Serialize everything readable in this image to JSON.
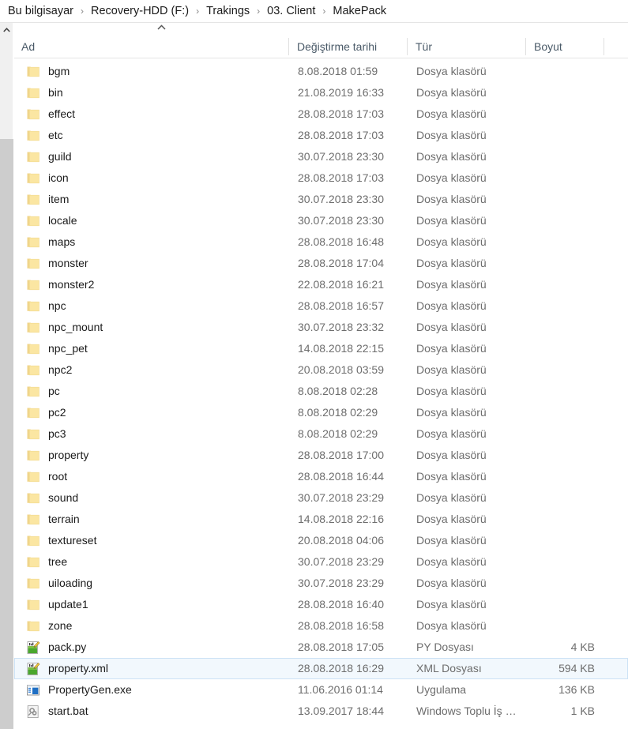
{
  "breadcrumb": {
    "separator": "›",
    "items": [
      {
        "label": "Bu bilgisayar"
      },
      {
        "label": "Recovery-HDD (F:)"
      },
      {
        "label": "Trakings"
      },
      {
        "label": "03. Client"
      },
      {
        "label": "MakePack"
      }
    ]
  },
  "columns": {
    "name": "Ad",
    "date": "Değiştirme tarihi",
    "type": "Tür",
    "size": "Boyut",
    "sort_indicator": "ascending-caret"
  },
  "scrollbar": {
    "up_arrow_icon": "chevron-up-icon"
  },
  "types": {
    "folder": "Dosya klasörü"
  },
  "rows": [
    {
      "name": "bgm",
      "date": "8.08.2018 01:59",
      "type": "Dosya klasörü",
      "size": "",
      "icon": "folder-icon",
      "selected": false
    },
    {
      "name": "bin",
      "date": "21.08.2019 16:33",
      "type": "Dosya klasörü",
      "size": "",
      "icon": "folder-icon",
      "selected": false
    },
    {
      "name": "effect",
      "date": "28.08.2018 17:03",
      "type": "Dosya klasörü",
      "size": "",
      "icon": "folder-icon",
      "selected": false
    },
    {
      "name": "etc",
      "date": "28.08.2018 17:03",
      "type": "Dosya klasörü",
      "size": "",
      "icon": "folder-icon",
      "selected": false
    },
    {
      "name": "guild",
      "date": "30.07.2018 23:30",
      "type": "Dosya klasörü",
      "size": "",
      "icon": "folder-icon",
      "selected": false
    },
    {
      "name": "icon",
      "date": "28.08.2018 17:03",
      "type": "Dosya klasörü",
      "size": "",
      "icon": "folder-icon",
      "selected": false
    },
    {
      "name": "item",
      "date": "30.07.2018 23:30",
      "type": "Dosya klasörü",
      "size": "",
      "icon": "folder-icon",
      "selected": false
    },
    {
      "name": "locale",
      "date": "30.07.2018 23:30",
      "type": "Dosya klasörü",
      "size": "",
      "icon": "folder-icon",
      "selected": false
    },
    {
      "name": "maps",
      "date": "28.08.2018 16:48",
      "type": "Dosya klasörü",
      "size": "",
      "icon": "folder-icon",
      "selected": false
    },
    {
      "name": "monster",
      "date": "28.08.2018 17:04",
      "type": "Dosya klasörü",
      "size": "",
      "icon": "folder-icon",
      "selected": false
    },
    {
      "name": "monster2",
      "date": "22.08.2018 16:21",
      "type": "Dosya klasörü",
      "size": "",
      "icon": "folder-icon",
      "selected": false
    },
    {
      "name": "npc",
      "date": "28.08.2018 16:57",
      "type": "Dosya klasörü",
      "size": "",
      "icon": "folder-icon",
      "selected": false
    },
    {
      "name": "npc_mount",
      "date": "30.07.2018 23:32",
      "type": "Dosya klasörü",
      "size": "",
      "icon": "folder-icon",
      "selected": false
    },
    {
      "name": "npc_pet",
      "date": "14.08.2018 22:15",
      "type": "Dosya klasörü",
      "size": "",
      "icon": "folder-icon",
      "selected": false
    },
    {
      "name": "npc2",
      "date": "20.08.2018 03:59",
      "type": "Dosya klasörü",
      "size": "",
      "icon": "folder-icon",
      "selected": false
    },
    {
      "name": "pc",
      "date": "8.08.2018 02:28",
      "type": "Dosya klasörü",
      "size": "",
      "icon": "folder-icon",
      "selected": false
    },
    {
      "name": "pc2",
      "date": "8.08.2018 02:29",
      "type": "Dosya klasörü",
      "size": "",
      "icon": "folder-icon",
      "selected": false
    },
    {
      "name": "pc3",
      "date": "8.08.2018 02:29",
      "type": "Dosya klasörü",
      "size": "",
      "icon": "folder-icon",
      "selected": false
    },
    {
      "name": "property",
      "date": "28.08.2018 17:00",
      "type": "Dosya klasörü",
      "size": "",
      "icon": "folder-icon",
      "selected": false
    },
    {
      "name": "root",
      "date": "28.08.2018 16:44",
      "type": "Dosya klasörü",
      "size": "",
      "icon": "folder-icon",
      "selected": false
    },
    {
      "name": "sound",
      "date": "30.07.2018 23:29",
      "type": "Dosya klasörü",
      "size": "",
      "icon": "folder-icon",
      "selected": false
    },
    {
      "name": "terrain",
      "date": "14.08.2018 22:16",
      "type": "Dosya klasörü",
      "size": "",
      "icon": "folder-icon",
      "selected": false
    },
    {
      "name": "textureset",
      "date": "20.08.2018 04:06",
      "type": "Dosya klasörü",
      "size": "",
      "icon": "folder-icon",
      "selected": false
    },
    {
      "name": "tree",
      "date": "30.07.2018 23:29",
      "type": "Dosya klasörü",
      "size": "",
      "icon": "folder-icon",
      "selected": false
    },
    {
      "name": "uiloading",
      "date": "30.07.2018 23:29",
      "type": "Dosya klasörü",
      "size": "",
      "icon": "folder-icon",
      "selected": false
    },
    {
      "name": "update1",
      "date": "28.08.2018 16:40",
      "type": "Dosya klasörü",
      "size": "",
      "icon": "folder-icon",
      "selected": false
    },
    {
      "name": "zone",
      "date": "28.08.2018 16:58",
      "type": "Dosya klasörü",
      "size": "",
      "icon": "folder-icon",
      "selected": false
    },
    {
      "name": "pack.py",
      "date": "28.08.2018 17:05",
      "type": "PY Dosyası",
      "size": "4 KB",
      "icon": "text-editor-doc-icon",
      "selected": false
    },
    {
      "name": "property.xml",
      "date": "28.08.2018 16:29",
      "type": "XML Dosyası",
      "size": "594 KB",
      "icon": "text-editor-doc-icon",
      "selected": true
    },
    {
      "name": "PropertyGen.exe",
      "date": "11.06.2016 01:14",
      "type": "Uygulama",
      "size": "136 KB",
      "icon": "application-icon",
      "selected": false
    },
    {
      "name": "start.bat",
      "date": "13.09.2017 18:44",
      "type": "Windows Toplu İş …",
      "size": "1 KB",
      "icon": "batch-file-icon",
      "selected": false
    }
  ],
  "colors": {
    "folder_fill": "#fbe6a2",
    "folder_tab": "#f2d98c",
    "selection_fill": "#f2f8fd",
    "selection_border": "#cce2f5",
    "header_text": "#4a5a68",
    "secondary_text": "#6d6d6d"
  }
}
